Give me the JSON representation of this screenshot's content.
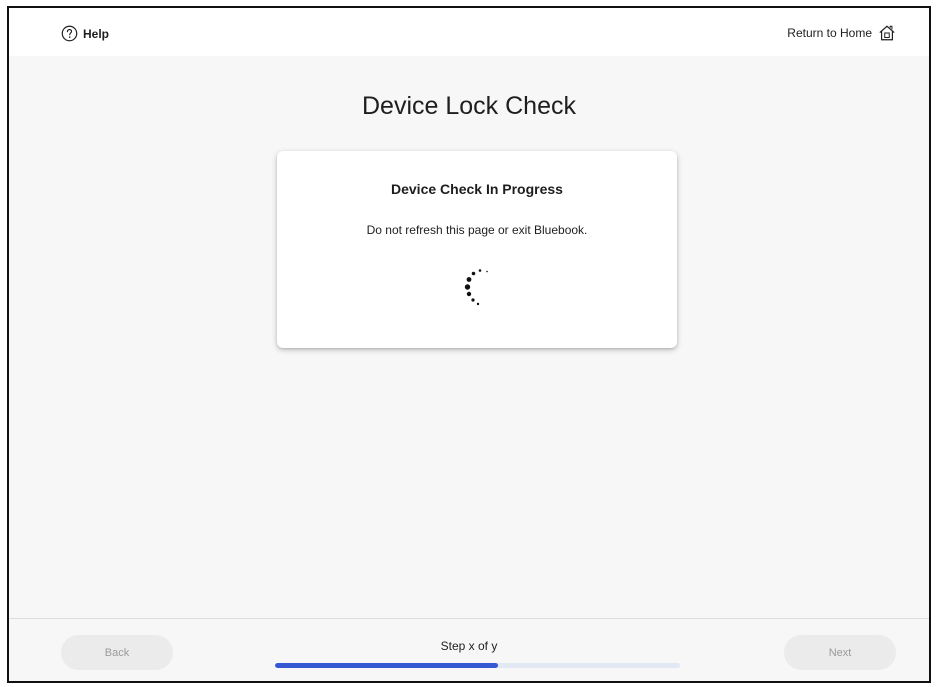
{
  "header": {
    "help_label": "Help",
    "home_label": "Return to Home"
  },
  "icons": {
    "help": "help-circle-icon",
    "home": "home-icon",
    "spinner": "loading-spinner-icon"
  },
  "main": {
    "title": "Device Lock Check",
    "card": {
      "heading": "Device Check In Progress",
      "message": "Do not refresh this page or exit Bluebook."
    }
  },
  "footer": {
    "back_label": "Back",
    "next_label": "Next",
    "step_text": "Step x of y",
    "progress_fraction": 0.55
  },
  "colors": {
    "accent": "#3558d3",
    "track": "#e3e8f5",
    "background": "#f7f7f7"
  }
}
